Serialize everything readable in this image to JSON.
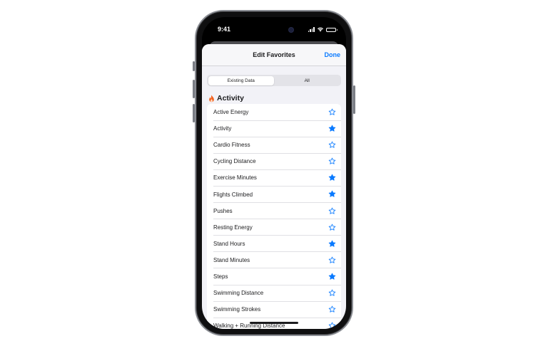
{
  "status": {
    "time": "9:41"
  },
  "nav": {
    "title": "Edit Favorites",
    "done_label": "Done"
  },
  "segments": [
    {
      "label": "Existing Data",
      "selected": true
    },
    {
      "label": "All",
      "selected": false
    }
  ],
  "section": {
    "icon": "flame-icon",
    "title": "Activity",
    "icon_color": "#f2621f"
  },
  "accent_color": "#0a7aff",
  "items": [
    {
      "label": "Active Energy",
      "favorite": false
    },
    {
      "label": "Activity",
      "favorite": true
    },
    {
      "label": "Cardio Fitness",
      "favorite": false
    },
    {
      "label": "Cycling Distance",
      "favorite": false
    },
    {
      "label": "Exercise Minutes",
      "favorite": true
    },
    {
      "label": "Flights Climbed",
      "favorite": true
    },
    {
      "label": "Pushes",
      "favorite": false
    },
    {
      "label": "Resting Energy",
      "favorite": false
    },
    {
      "label": "Stand Hours",
      "favorite": true
    },
    {
      "label": "Stand Minutes",
      "favorite": false
    },
    {
      "label": "Steps",
      "favorite": true
    },
    {
      "label": "Swimming Distance",
      "favorite": false
    },
    {
      "label": "Swimming Strokes",
      "favorite": false
    },
    {
      "label": "Walking + Running Distance",
      "favorite": false
    }
  ]
}
